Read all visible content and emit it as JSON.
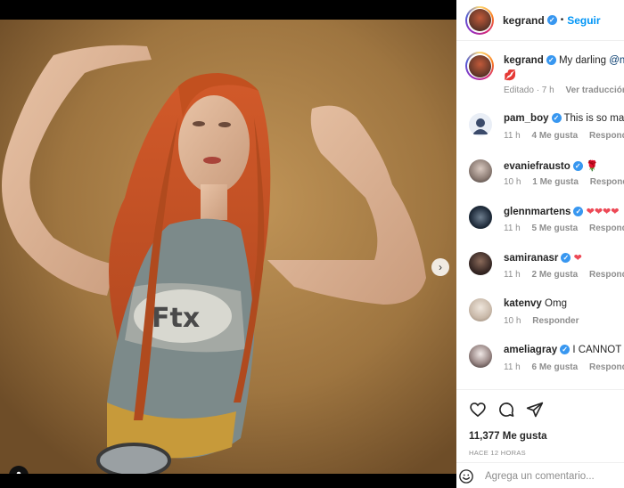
{
  "post": {
    "author": "kegrand",
    "follow_label": "Seguir",
    "bullet": "•",
    "media": {
      "description_icon": "photo",
      "carousel_dots": 8,
      "active_dot": 0
    }
  },
  "caption": {
    "user": "kegrand",
    "text_before": "My darling ",
    "mention": "@nic",
    "emoji": "💋",
    "edited": "Editado · 7 h",
    "see_translation": "Ver traducción"
  },
  "comments": [
    {
      "user": "pam_boy",
      "text": "This is so major",
      "time": "11 h",
      "likes": "4 Me gusta",
      "reply": "Responder"
    },
    {
      "user": "evaniefrausto",
      "text": "🌹",
      "time": "10 h",
      "likes": "1 Me gusta",
      "reply": "Responder"
    },
    {
      "user": "glennmartens",
      "text": "❤❤❤❤",
      "time": "11 h",
      "likes": "5 Me gusta",
      "reply": "Responder"
    },
    {
      "user": "samiranasr",
      "text": "❤",
      "time": "11 h",
      "likes": "2 Me gusta",
      "reply": "Responder"
    },
    {
      "user": "katenvy",
      "text": "Omg",
      "time": "10 h",
      "likes": "",
      "reply": "Responder"
    },
    {
      "user": "ameliagray",
      "text": "I CANNOT TAKE IT",
      "time": "11 h",
      "likes": "6 Me gusta",
      "reply": "Responder"
    }
  ],
  "actions": {
    "likes_count": "11,377 Me gusta",
    "time_ago": "HACE 12 HORAS",
    "comment_placeholder": "Agrega un comentario..."
  },
  "colors": {
    "accent": "#0095f6",
    "verified": "#3897f0",
    "heart": "#ed4956",
    "meta": "#8e8e8e"
  }
}
